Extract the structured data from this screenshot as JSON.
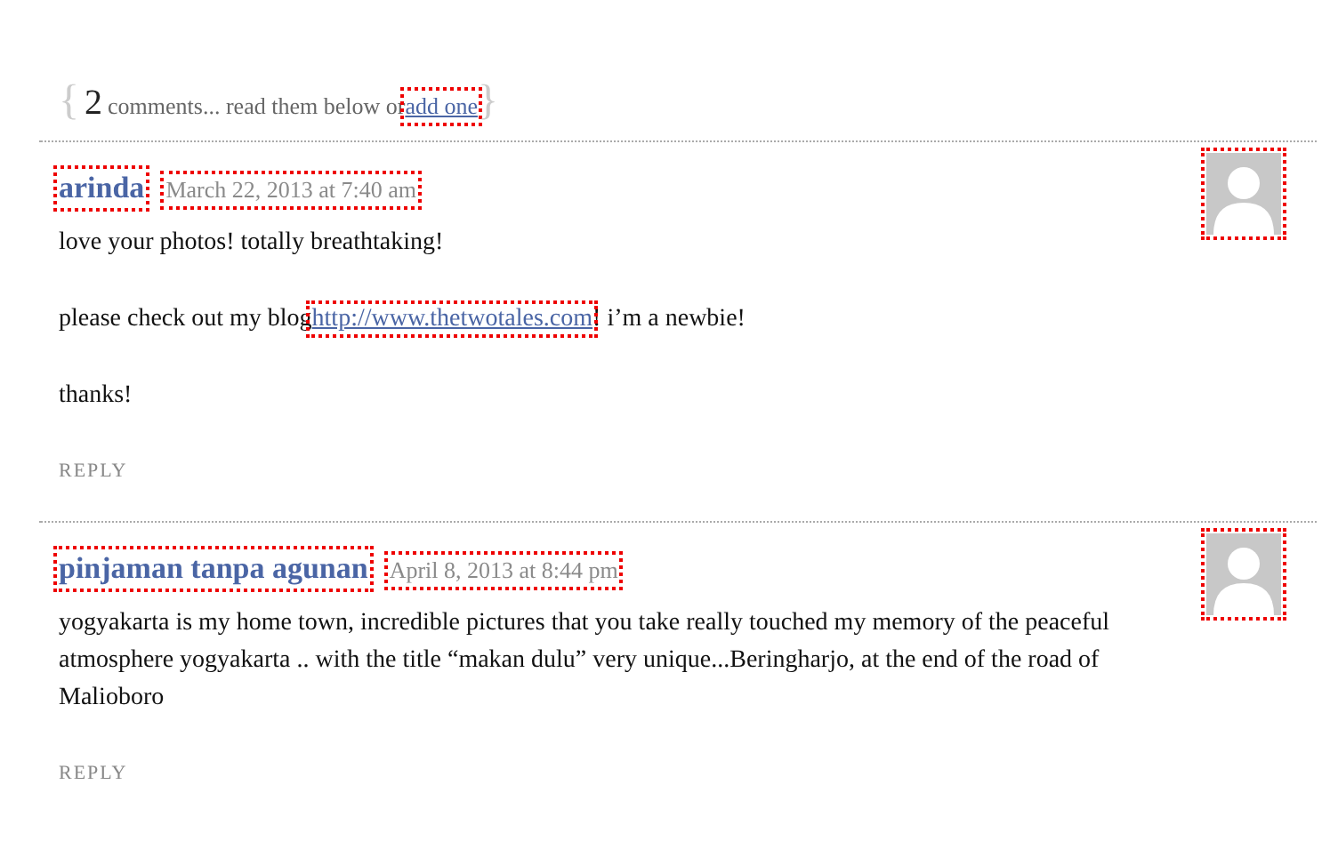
{
  "header": {
    "open_brace": "{",
    "count": "2",
    "text": "comments... read them below or",
    "link": "add one",
    "close_brace": "}"
  },
  "comments": [
    {
      "author": "arinda",
      "date": "March 22, 2013 at 7:40 am",
      "paragraphs": [
        [
          {
            "kind": "text",
            "text": "love your photos! totally breathtaking!"
          }
        ],
        [
          {
            "kind": "text",
            "text": "please check out my blog"
          },
          {
            "kind": "link",
            "text": "http://www.thetwotales.com"
          },
          {
            "kind": "text",
            "text": "! i’m a newbie!"
          }
        ],
        [
          {
            "kind": "text",
            "text": "thanks!"
          }
        ]
      ],
      "reply": "REPLY"
    },
    {
      "author": "pinjaman tanpa agunan",
      "date": "April 8, 2013 at 8:44 pm",
      "paragraphs": [
        [
          {
            "kind": "text",
            "text": "yogyakarta is my home town, incredible pictures that you take really touched my memory of the peaceful atmosphere yogyakarta .. with the title “makan dulu” very unique...Beringharjo, at the end of the road of Malioboro"
          }
        ]
      ],
      "reply": "REPLY"
    }
  ]
}
